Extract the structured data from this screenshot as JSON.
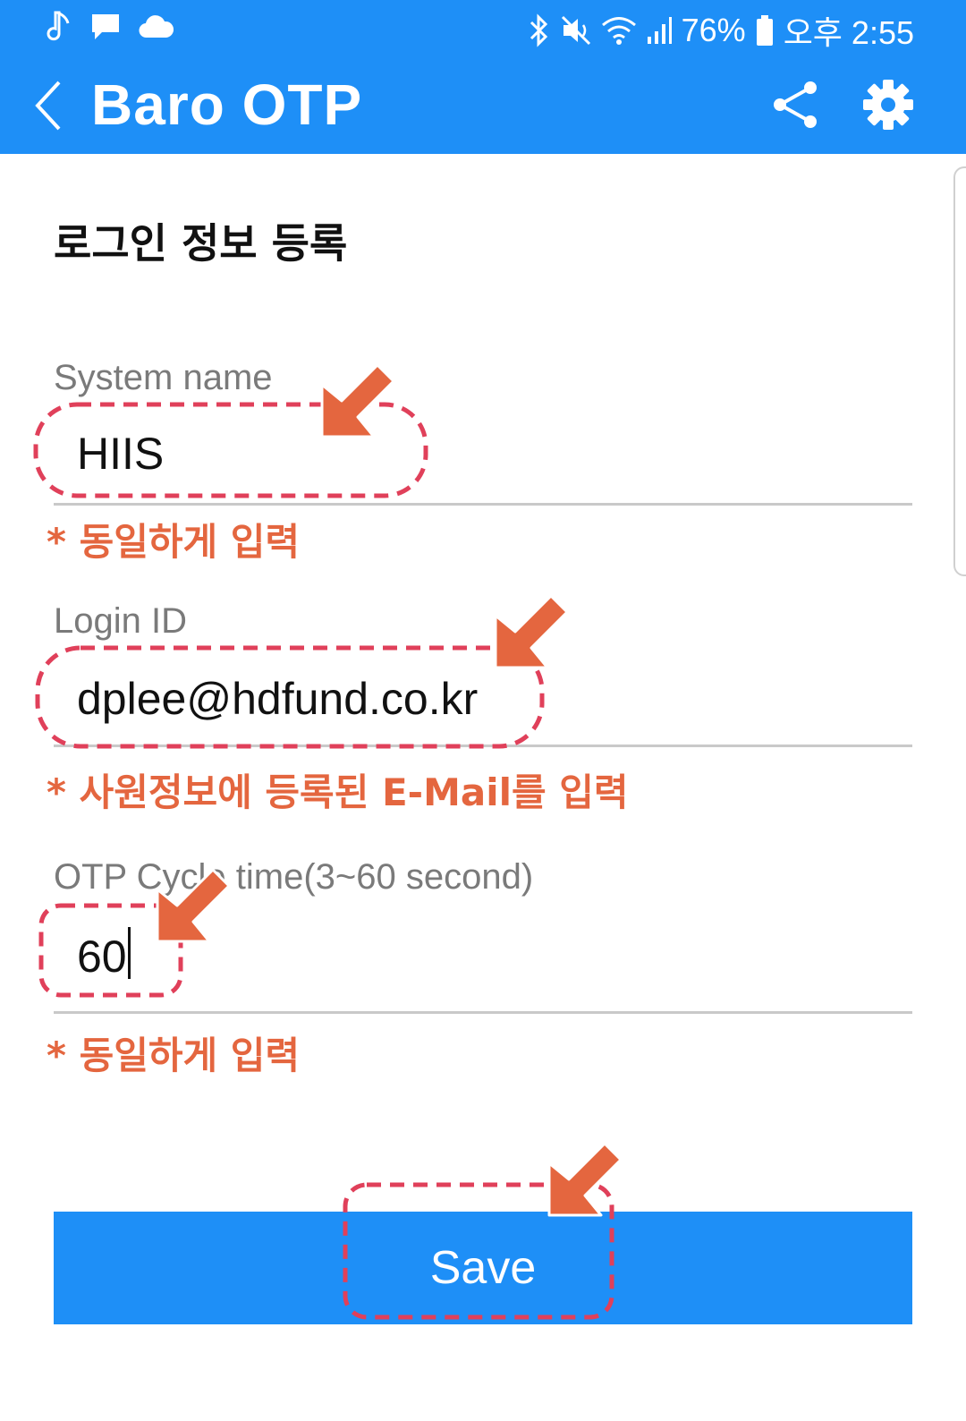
{
  "status_bar": {
    "battery": "76%",
    "time": "오후 2:55",
    "left_icons": [
      "music-note-icon",
      "message-icon",
      "cloud-icon"
    ],
    "right_icons": [
      "bluetooth-icon",
      "mute-icon",
      "wifi-icon",
      "signal-icon",
      "battery-icon"
    ]
  },
  "app_bar": {
    "title": "Baro OTP",
    "color": "#1e8ff7",
    "icons": [
      "back-chevron-icon",
      "share-icon",
      "gear-icon"
    ]
  },
  "page": {
    "title": "로그인 정보 등록"
  },
  "form": {
    "system_name": {
      "label": "System name",
      "value": "HIIS"
    },
    "login_id": {
      "label": "Login ID",
      "value": "dplee@hdfund.co.kr"
    },
    "cycle_time": {
      "label": "OTP Cycle time(3~60 second)",
      "value": "60"
    }
  },
  "annotations": {
    "hint_system_name": "* 동일하게 입력",
    "hint_login_id": "* 사원정보에 등록된 E-Mail를 입력",
    "hint_cycle_time": "* 동일하게 입력",
    "highlight_color": "#e0405a",
    "arrow_color": "#e4663f"
  },
  "actions": {
    "save_label": "Save"
  }
}
